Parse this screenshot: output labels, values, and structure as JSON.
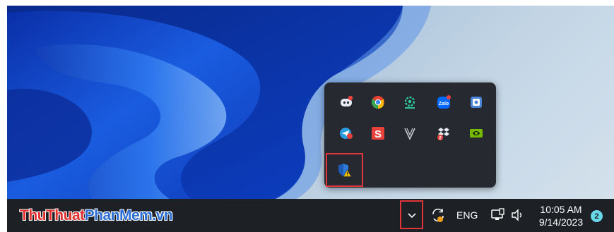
{
  "brand": {
    "part1": "ThuThuat",
    "part2": "PhanMem.vn"
  },
  "taskbar": {
    "overflow_icon": "chevron-up-icon",
    "tray": [
      {
        "name": "sync-icon"
      },
      {
        "name": "language",
        "label": "ENG"
      },
      {
        "name": "network-icon"
      },
      {
        "name": "volume-icon"
      }
    ],
    "clock": {
      "time": "10:05 AM",
      "date": "9/14/2023"
    },
    "notification_count": "2"
  },
  "tray_popup": {
    "icons": [
      "discord-icon",
      "chrome-icon",
      "settings-sync-icon",
      "zalo-icon",
      "screenshot-icon",
      "telegram-icon",
      "unikey-icon",
      "vectorize-icon",
      "dropbox-icon",
      "nvidia-icon",
      "windows-security-warning-icon"
    ]
  },
  "colors": {
    "taskbar_bg": "#1d2126",
    "popup_bg": "#262a30",
    "highlight": "#e0363a",
    "brand_red": "#e0312f",
    "brand_blue": "#2b6fd6",
    "badge": "#6ad7e8"
  }
}
